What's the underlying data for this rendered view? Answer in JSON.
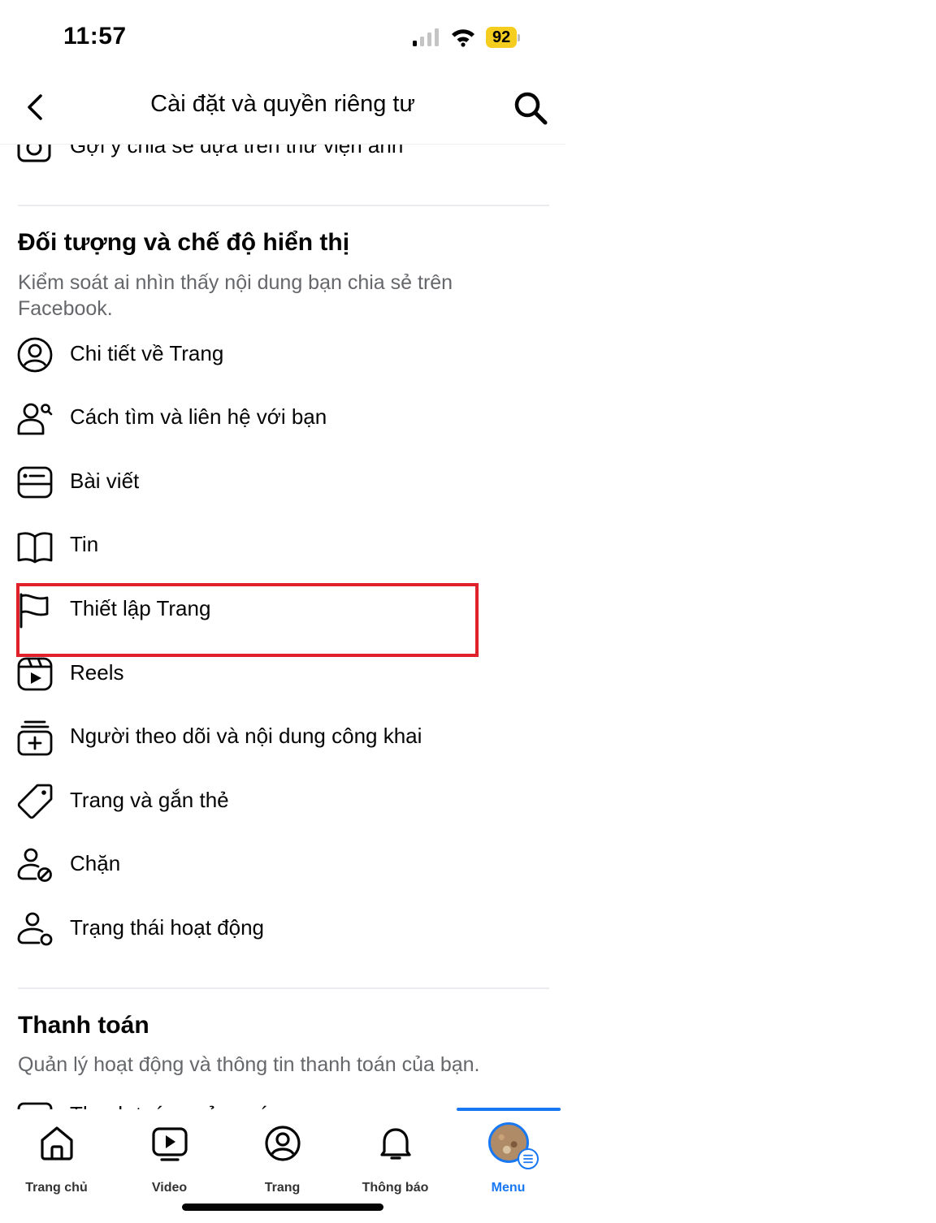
{
  "status_bar": {
    "time": "11:57",
    "battery": "92"
  },
  "nav": {
    "title": "Cài đặt và quyền riêng tư",
    "back_icon": "chevron-left-icon",
    "search_icon": "search-icon"
  },
  "partial_top_item": {
    "label": "Gợi ý chia sẻ dựa trên thư viện ảnh",
    "icon": "camera-icon"
  },
  "section_audience": {
    "title": "Đối tượng và chế độ hiển thị",
    "description": "Kiểm soát ai nhìn thấy nội dung bạn chia sẻ trên Facebook.",
    "items": [
      {
        "label": "Chi tiết về Trang",
        "icon": "profile-circle-icon"
      },
      {
        "label": "Cách tìm và liên hệ với bạn",
        "icon": "person-search-icon"
      },
      {
        "label": "Bài viết",
        "icon": "post-card-icon"
      },
      {
        "label": "Tin",
        "icon": "book-icon"
      },
      {
        "label": "Thiết lập Trang",
        "icon": "flag-icon"
      },
      {
        "label": "Reels",
        "icon": "reels-icon"
      },
      {
        "label": "Người theo dõi và nội dung công khai",
        "icon": "add-card-icon"
      },
      {
        "label": "Trang và gắn thẻ",
        "icon": "tag-icon"
      },
      {
        "label": "Chặn",
        "icon": "block-person-icon"
      },
      {
        "label": "Trạng thái hoạt động",
        "icon": "active-status-icon"
      }
    ]
  },
  "section_payments": {
    "title": "Thanh toán",
    "description": "Quản lý hoạt động và thông tin thanh toán của bạn.",
    "partial_item": {
      "label": "Thanh toán quảng cáo",
      "icon": "card-icon"
    }
  },
  "highlight_color": "#e0202a",
  "accent_color": "#1877f2",
  "tab_bar": {
    "tabs": [
      {
        "label": "Trang chủ",
        "icon": "home-icon"
      },
      {
        "label": "Video",
        "icon": "video-icon"
      },
      {
        "label": "Trang",
        "icon": "profile-icon"
      },
      {
        "label": "Thông báo",
        "icon": "bell-icon"
      },
      {
        "label": "Menu",
        "icon": "avatar-menu-icon",
        "active": true
      }
    ]
  }
}
